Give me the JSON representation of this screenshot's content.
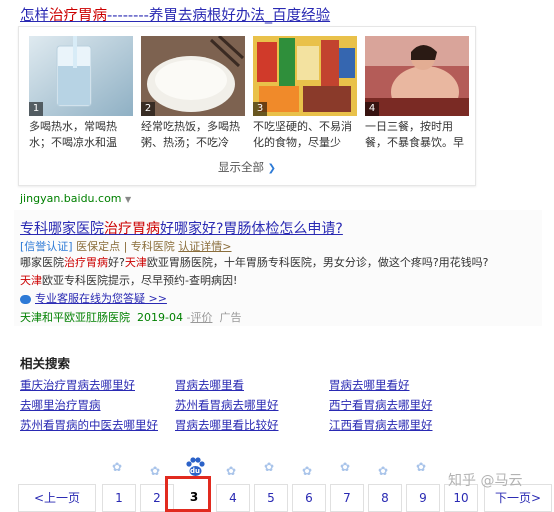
{
  "result1": {
    "title_pre": "怎样",
    "title_hl": "治疗胃病",
    "title_post": "--------养胃去病根好办法_百度经验",
    "steps": [
      {
        "num": "1",
        "caption": "多喝热水，常喝热水；不喝凉水和温水。..."
      },
      {
        "num": "2",
        "caption": "经常吃热饭，多喝热粥、热汤；不吃冷食..."
      },
      {
        "num": "3",
        "caption": "不吃坚硬的、不易消化的食物，尽量少吃..."
      },
      {
        "num": "4",
        "caption": "一日三餐，按时用餐，不暴食暴饮。早饭..."
      }
    ],
    "show_all": "显示全部",
    "domain": "jingyan.baidu.com"
  },
  "ad": {
    "title_pre": "专科哪家医院",
    "title_hl": "治疗胃病",
    "title_post": "好哪家好?胃肠体检怎么申请?",
    "badge": "[信誉认证]",
    "tags": "医保定点 | 专科医院",
    "cert_link": "认证详情>",
    "desc_1": "哪家医院",
    "desc_hl1": "治疗胃病",
    "desc_2": "好?",
    "desc_hl2": "天津",
    "desc_3": "欧亚胃肠医院，十年胃肠专科医院，男女分诊，做这个疼吗?用花钱吗?",
    "desc_hl3": "天津",
    "desc_4": "欧亚专科医院提示，尽早预约-查明病因!",
    "service_link": "专业客服在线为您答疑 >>",
    "foot_name": "天津和平欧亚肛肠医院",
    "foot_date": "2019-04",
    "foot_eval": "评价",
    "foot_ad": "广告"
  },
  "related": {
    "heading": "相关搜索",
    "items": [
      "重庆治疗胃病去哪里好",
      "胃病去哪里看",
      "胃病去哪里看好",
      "去哪里治疗胃病",
      "苏州看胃病去哪里好",
      "西宁看胃病去哪里好",
      "苏州看胃病的中医去哪里好",
      "胃病去哪里看比较好",
      "江西看胃病去哪里好"
    ]
  },
  "pagination": {
    "prev": "<上一页",
    "pages": [
      "1",
      "2",
      "3",
      "4",
      "5",
      "6",
      "7",
      "8",
      "9",
      "10"
    ],
    "current": "3",
    "next": "下一页>",
    "du_label": "du"
  },
  "watermark": "知乎 @马云",
  "colors": {
    "link": "#2a2ab3",
    "highlight": "#cc0000",
    "green": "#008000",
    "current_box": "#e12a1f"
  }
}
